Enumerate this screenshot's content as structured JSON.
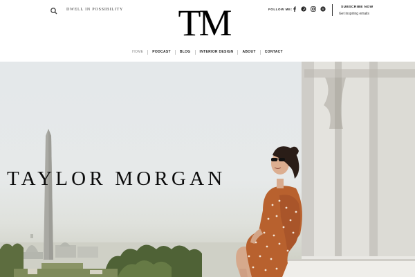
{
  "header": {
    "tagline": "DWELL IN POSSIBILITY",
    "logo_text": "TM",
    "follow_label": "FOLLOW ME:",
    "social_icons": [
      "facebook-icon",
      "pinterest-icon",
      "instagram-icon",
      "spotify-icon"
    ],
    "subscribe_title": "SUBSCRIBE NOW",
    "subscribe_subtitle": "Get inspiring emails"
  },
  "nav": {
    "items": [
      {
        "label": "HOME",
        "active": true
      },
      {
        "label": "PODCAST",
        "active": false
      },
      {
        "label": "BLOG",
        "active": false
      },
      {
        "label": "INTERIOR DESIGN",
        "active": false
      },
      {
        "label": "ABOUT",
        "active": false
      },
      {
        "label": "CONTACT",
        "active": false
      }
    ]
  },
  "hero": {
    "title": "TAYLOR MORGAN"
  },
  "colors": {
    "text": "#222222",
    "nav_active": "#888888",
    "dress": "#b8612e",
    "sky": "#e4e8ea"
  }
}
